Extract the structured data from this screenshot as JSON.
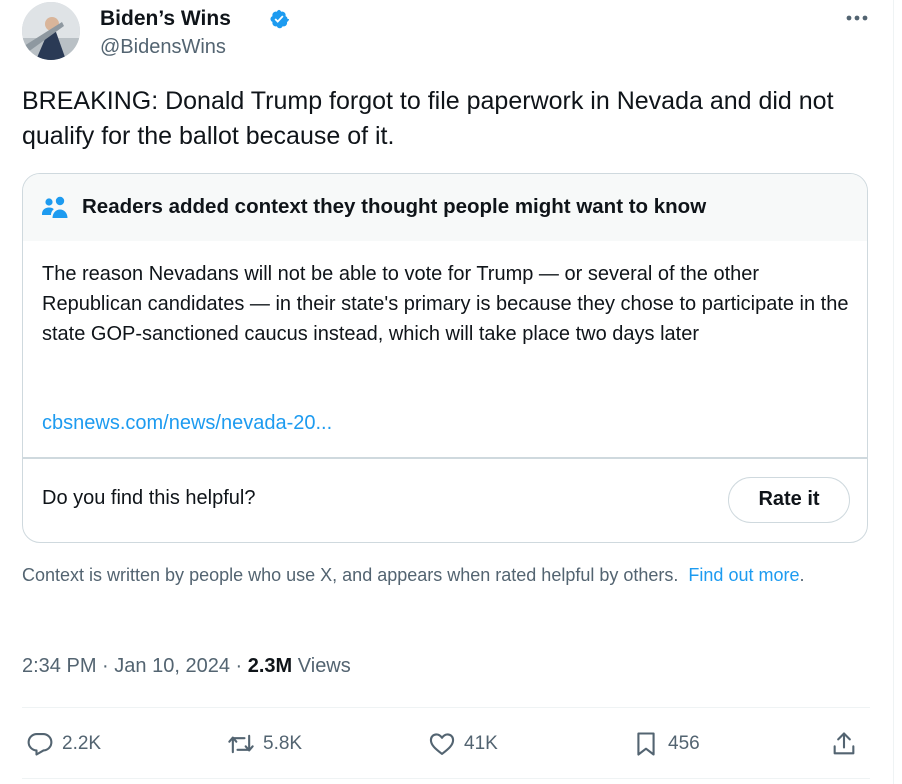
{
  "author": {
    "display_name": "Biden’s Wins",
    "handle": "@BidensWins",
    "verified": true
  },
  "tweet": {
    "text": "BREAKING: Donald Trump forgot to file paperwork in Nevada and did not qualify for the ballot because of it."
  },
  "community_note": {
    "title": "Readers added context they thought people might want to know",
    "body": "The reason Nevadans will not be able to vote for Trump — or several of the other Republican candidates — in their state's primary is because they chose to participate in the state GOP-sanctioned caucus instead, which will take place two days later",
    "link": "cbsnews.com/news/nevada-20...",
    "helpful_question": "Do you find this helpful?",
    "rate_button": "Rate it"
  },
  "context_footer": {
    "text": "Context is written by people who use X, and appears when rated helpful by others.",
    "link": "Find out more",
    "period": "."
  },
  "meta": {
    "time": "2:34 PM",
    "separator": "·",
    "date": "Jan 10, 2024",
    "views_count": "2.3M",
    "views_label": "Views"
  },
  "actions": {
    "replies": "2.2K",
    "reposts": "5.8K",
    "likes": "41K",
    "bookmarks": "456"
  },
  "colors": {
    "accent": "#1d9bf0",
    "text": "#0f1419",
    "muted": "#536471",
    "border": "#cfd9de"
  }
}
